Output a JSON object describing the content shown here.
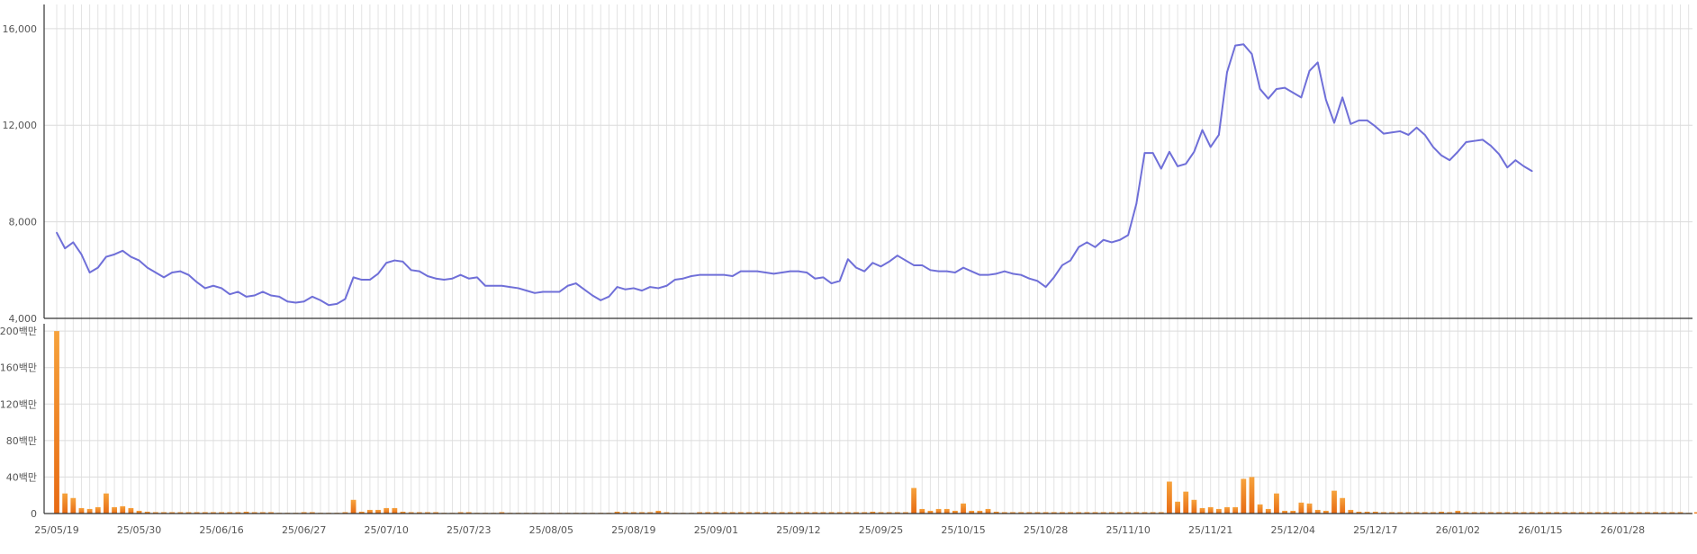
{
  "chart_data": [
    {
      "type": "line",
      "panel": "price",
      "xlabel": "",
      "ylabel": "",
      "ylim": [
        4000,
        17000
      ],
      "yticks": [
        {
          "value": 4000,
          "label": "4,000"
        },
        {
          "value": 8000,
          "label": "8,000"
        },
        {
          "value": 12000,
          "label": "12,000"
        },
        {
          "value": 16000,
          "label": "16,000"
        }
      ],
      "grid": true,
      "color": "#6f6fd8",
      "series": [
        {
          "values": [
            7550,
            6900,
            7150,
            6650,
            5900,
            6100,
            6550,
            6650,
            6800,
            6550,
            6400,
            6100,
            5900,
            5700,
            5900,
            5950,
            5800,
            5500,
            5250,
            5350,
            5250,
            5000,
            5100,
            4900,
            4950,
            5100,
            4950,
            4900,
            4700,
            4650,
            4700,
            4900,
            4750,
            4550,
            4600,
            4800,
            5700,
            5600,
            5600,
            5850,
            6300,
            6400,
            6350,
            6000,
            5950,
            5750,
            5650,
            5600,
            5650,
            5800,
            5650,
            5700,
            5350,
            5350,
            5350,
            5300,
            5250,
            5150,
            5050,
            5100,
            5100,
            5100,
            5350,
            5450,
            5200,
            4950,
            4750,
            4900,
            5300,
            5200,
            5250,
            5150,
            5300,
            5250,
            5350,
            5600,
            5650,
            5750,
            5800,
            5800,
            5800,
            5800,
            5750,
            5950,
            5950,
            5950,
            5900,
            5850,
            5900,
            5950,
            5950,
            5900,
            5650,
            5700,
            5450,
            5550,
            6450,
            6100,
            5950,
            6300,
            6150,
            6350,
            6600,
            6400,
            6200,
            6200,
            6000,
            5950,
            5950,
            5900,
            6100,
            5950,
            5800,
            5800,
            5850,
            5950,
            5850,
            5800,
            5650,
            5550,
            5300,
            5700,
            6200,
            6400,
            6950,
            7150,
            6950,
            7250,
            7150,
            7250,
            7450,
            8750,
            10850,
            10850,
            10200,
            10900,
            10300,
            10400,
            10900,
            11800,
            11100,
            11600,
            14200,
            15300,
            15350,
            14950,
            13500,
            13100,
            13500,
            13550,
            13350,
            13150,
            14250,
            14600,
            13050,
            12100,
            13150,
            12050,
            12200,
            12200,
            11950,
            11650,
            11700,
            11750,
            11600,
            11900,
            11600,
            11100,
            10750,
            10550,
            10900,
            11300,
            11350,
            11400,
            11150,
            10800,
            10250,
            10550,
            10300,
            10100
          ]
        }
      ]
    },
    {
      "type": "bar",
      "panel": "volume",
      "xlabel": "",
      "ylabel": "",
      "ylim": [
        0,
        208
      ],
      "yticks": [
        {
          "value": 0,
          "label": "0"
        },
        {
          "value": 40,
          "label": "40백만"
        },
        {
          "value": 80,
          "label": "80백만"
        },
        {
          "value": 120,
          "label": "120백만"
        },
        {
          "value": 160,
          "label": "160백만"
        },
        {
          "value": 200,
          "label": "200백만"
        }
      ],
      "grid": true,
      "color_top": "#f6a23c",
      "color_bottom": "#e76a13",
      "series": [
        {
          "values": [
            200,
            22,
            17,
            6,
            5,
            7,
            22,
            7,
            8,
            6,
            3,
            2,
            1.5,
            1.5,
            1.5,
            1.5,
            1.5,
            1.5,
            1.5,
            1.5,
            1.5,
            1.5,
            1.5,
            2,
            1.5,
            1.5,
            1.5,
            0.8,
            0.8,
            0.8,
            1.5,
            1.5,
            0.8,
            0.8,
            0.8,
            1.5,
            15,
            2,
            4,
            4,
            6,
            6,
            2,
            1.5,
            1.5,
            1.5,
            1.5,
            0.8,
            0.8,
            1.5,
            1.5,
            0.8,
            0.8,
            0.8,
            1.5,
            0.8,
            0.8,
            0.8,
            0.8,
            0.8,
            0.8,
            0.8,
            0.8,
            0.8,
            0.8,
            0.8,
            0.8,
            0.8,
            2,
            1.5,
            1.5,
            1.5,
            1.5,
            3,
            1.5,
            0.8,
            0.8,
            0.8,
            1.5,
            1.5,
            1.5,
            1.5,
            1.5,
            1.5,
            1.5,
            1.5,
            1.5,
            1.5,
            1.5,
            1.5,
            1.5,
            1.5,
            1.5,
            1.5,
            1.5,
            1.5,
            1.5,
            1.5,
            1.5,
            2,
            1.5,
            1.5,
            1.5,
            1.5,
            28,
            5,
            3,
            5,
            5,
            3,
            11,
            3,
            3,
            5,
            2,
            1.5,
            1.5,
            1.5,
            1.5,
            1.5,
            1.5,
            1.5,
            1.5,
            1.5,
            1.5,
            1.5,
            1.5,
            1.5,
            1.5,
            1.5,
            1.5,
            1.5,
            1.5,
            1.5,
            1.5,
            35,
            13,
            24,
            15,
            6,
            7,
            5,
            7,
            7,
            38,
            40,
            10,
            5,
            22,
            3,
            3,
            12,
            11,
            4,
            3,
            25,
            17,
            4,
            2,
            2,
            2,
            1.5,
            1.5,
            1.5,
            1.5,
            1.5,
            1.5,
            1.5,
            2,
            1.5,
            3,
            1.5,
            1.5,
            1.5,
            1.5,
            1.5,
            1.5,
            1.5,
            1.5,
            1.5,
            1.5,
            1.5,
            1.5,
            1.5,
            1.5,
            1.5,
            1.5,
            1.5,
            1.5,
            1.5,
            1.5,
            1.5,
            1.5,
            1.5,
            1.5,
            1.5,
            1.5,
            1.5,
            0.8,
            1.5,
            1.5
          ]
        }
      ]
    }
  ],
  "x_axis": {
    "count": 201,
    "ticks": [
      {
        "index": 0,
        "label": "25/05/19"
      },
      {
        "index": 10,
        "label": "25/05/30"
      },
      {
        "index": 20,
        "label": "25/06/16"
      },
      {
        "index": 30,
        "label": "25/06/27"
      },
      {
        "index": 40,
        "label": "25/07/10"
      },
      {
        "index": 50,
        "label": "25/07/23"
      },
      {
        "index": 60,
        "label": "25/08/05"
      },
      {
        "index": 70,
        "label": "25/08/19"
      },
      {
        "index": 80,
        "label": "25/09/01"
      },
      {
        "index": 90,
        "label": "25/09/12"
      },
      {
        "index": 100,
        "label": "25/09/25"
      },
      {
        "index": 110,
        "label": "25/10/15"
      },
      {
        "index": 120,
        "label": "25/10/28"
      },
      {
        "index": 130,
        "label": "25/11/10"
      },
      {
        "index": 140,
        "label": "25/11/21"
      },
      {
        "index": 150,
        "label": "25/12/04"
      },
      {
        "index": 160,
        "label": "25/12/17"
      },
      {
        "index": 170,
        "label": "26/01/02"
      },
      {
        "index": 180,
        "label": "26/01/15"
      },
      {
        "index": 190,
        "label": "26/01/28"
      }
    ]
  }
}
